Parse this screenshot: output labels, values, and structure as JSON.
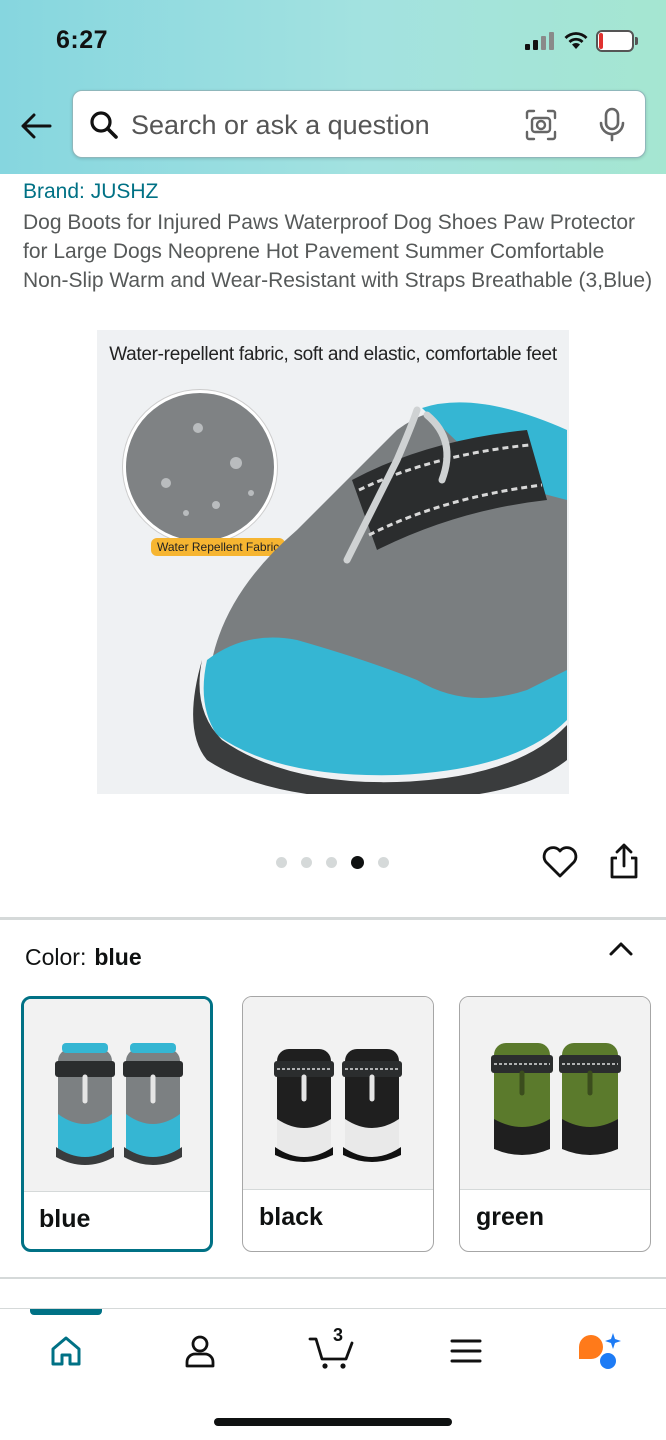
{
  "status_bar": {
    "time": "6:27",
    "battery_level": "11",
    "battery_color": "#e0312f"
  },
  "header": {
    "back_icon": "arrow-left-icon",
    "search": {
      "placeholder": "Search or ask a question",
      "icons": [
        "search-icon",
        "camera-scan-icon",
        "microphone-icon"
      ]
    },
    "gradient_colors": [
      "#86d6df",
      "#a5e6d1"
    ]
  },
  "product": {
    "brand": "Brand: JUSHZ",
    "title": "Dog Boots for Injured Paws Waterproof Dog Shoes Paw Protector for Large Dogs Neoprene Hot Pavement Summer Comfortable Non-Slip Warm and Wear-Resistant with Straps Breathable (3,Blue)",
    "image": {
      "caption": "Water-repellent fabric, soft and elastic, comfortable feet",
      "badge": "Water Repellent Fabric"
    },
    "carousel": {
      "total": 5,
      "active_index": 3
    },
    "actions": [
      "heart-icon",
      "share-icon"
    ]
  },
  "color_selector": {
    "label": "Color:",
    "selected": "blue",
    "options": [
      {
        "label": "blue",
        "accent": "#35b6d3",
        "selected": true
      },
      {
        "label": "black",
        "accent": "#1f1f1f",
        "selected": false
      },
      {
        "label": "green",
        "accent": "#5b7a2c",
        "selected": false
      }
    ],
    "accent_color": "#007185"
  },
  "bottom_nav": {
    "items": [
      "home-icon",
      "account-icon",
      "cart-icon",
      "menu-icon",
      "rufus-assistant-icon"
    ],
    "cart_count": "3",
    "active": "home-icon"
  }
}
